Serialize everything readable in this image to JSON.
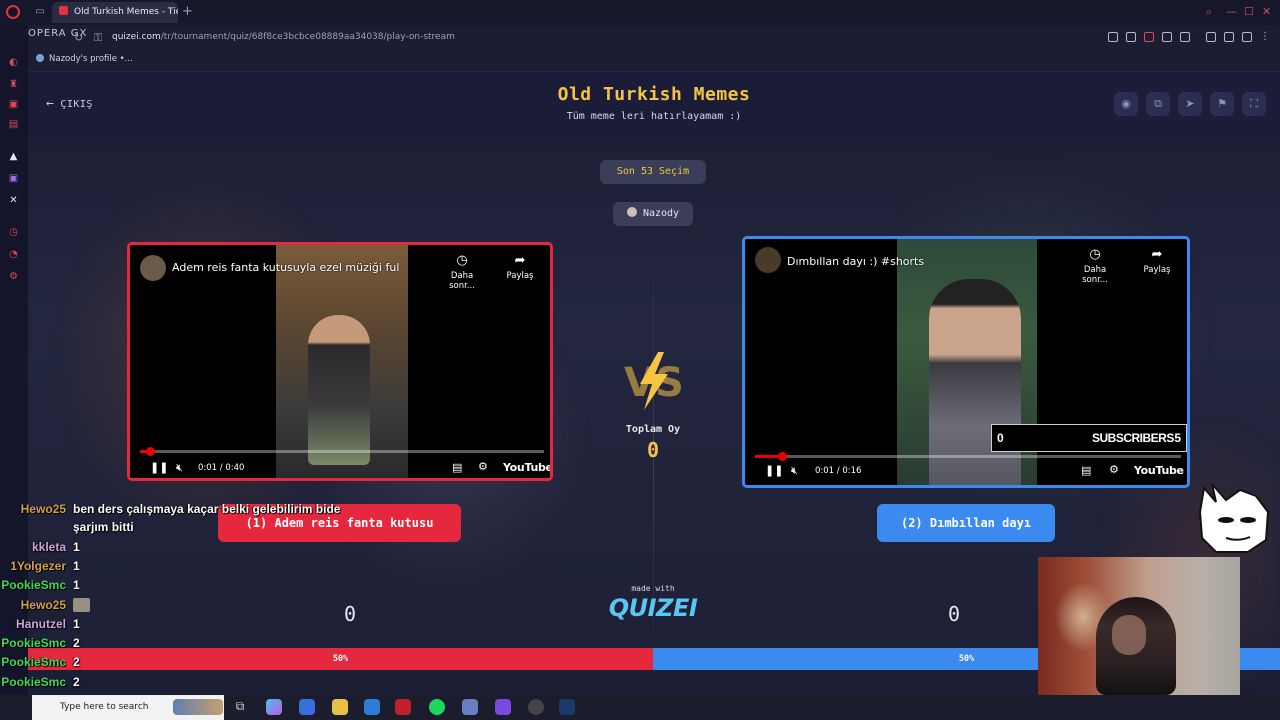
{
  "browser": {
    "tab_title": "Old Turkish Memes - Tier",
    "tab_close": "×",
    "new_tab": "+",
    "url_domain": "quizei.com",
    "url_path": "/tr/tournament/quiz/68f8ce3bcbce08889aa34038/play-on-stream",
    "bookmark": "Nazody's profile •..."
  },
  "page": {
    "back_label": "ÇIKIŞ",
    "title": "Old Turkish Memes",
    "subtitle": "Tüm meme leri hatırlayamam :)",
    "last_votes": "Son 53 Seçim",
    "streamer": "Nazody",
    "total_votes_label": "Toplam Oy",
    "total_votes_value": "0",
    "made_with": "made with",
    "brand": "QUIZEI"
  },
  "left": {
    "video_title": "Adem reis fanta kutusuyla ezel müziği ful",
    "watch_later": "Daha sonr...",
    "share": "Paylaş",
    "time": "0:01 / 0:40",
    "progress": 0.025,
    "brand": "YouTube",
    "choice_label": "(1) Adem reis fanta kutusu",
    "score": "0",
    "percent": "50%",
    "color": "#e6283f"
  },
  "right": {
    "video_title": "Dımbıllan dayı :) #shorts",
    "watch_later": "Daha sonr...",
    "share": "Paylaş",
    "time": "0:01 / 0:16",
    "progress": 0.0625,
    "brand": "YouTube",
    "choice_label": "(2) Dımbıllan dayı",
    "score": "0",
    "percent": "50%",
    "color": "#3a8af0"
  },
  "overlay": {
    "subscribers_label": "SUBSCRIBERS",
    "subscribers_left": "0",
    "subscribers_right": "5",
    "chat": [
      {
        "user": "Hewo25",
        "color": "#d4a04a",
        "msg": "ben ders çalışmaya kaçar belki gelebilirim bide"
      },
      {
        "user": "",
        "color": "#ffffff",
        "msg": "şarjım bitti"
      },
      {
        "user": "kkleta",
        "color": "#cfa3e0",
        "msg": "1"
      },
      {
        "user": "1Yolgezer",
        "color": "#d4a04a",
        "msg": "1"
      },
      {
        "user": "PookieSmc",
        "color": "#3ddc5a",
        "msg": "1"
      },
      {
        "user": "Hewo25",
        "color": "#d4a04a",
        "msg": ""
      },
      {
        "user": "Hanutzel",
        "color": "#cfa3e0",
        "msg": "1"
      },
      {
        "user": "PookieSmc",
        "color": "#3ddc5a",
        "msg": "2"
      },
      {
        "user": "PookieSmc",
        "color": "#3ddc5a",
        "msg": "2"
      },
      {
        "user": "PookieSmc",
        "color": "#3ddc5a",
        "msg": "2"
      }
    ]
  },
  "taskbar": {
    "search_placeholder": "Type here to search"
  }
}
